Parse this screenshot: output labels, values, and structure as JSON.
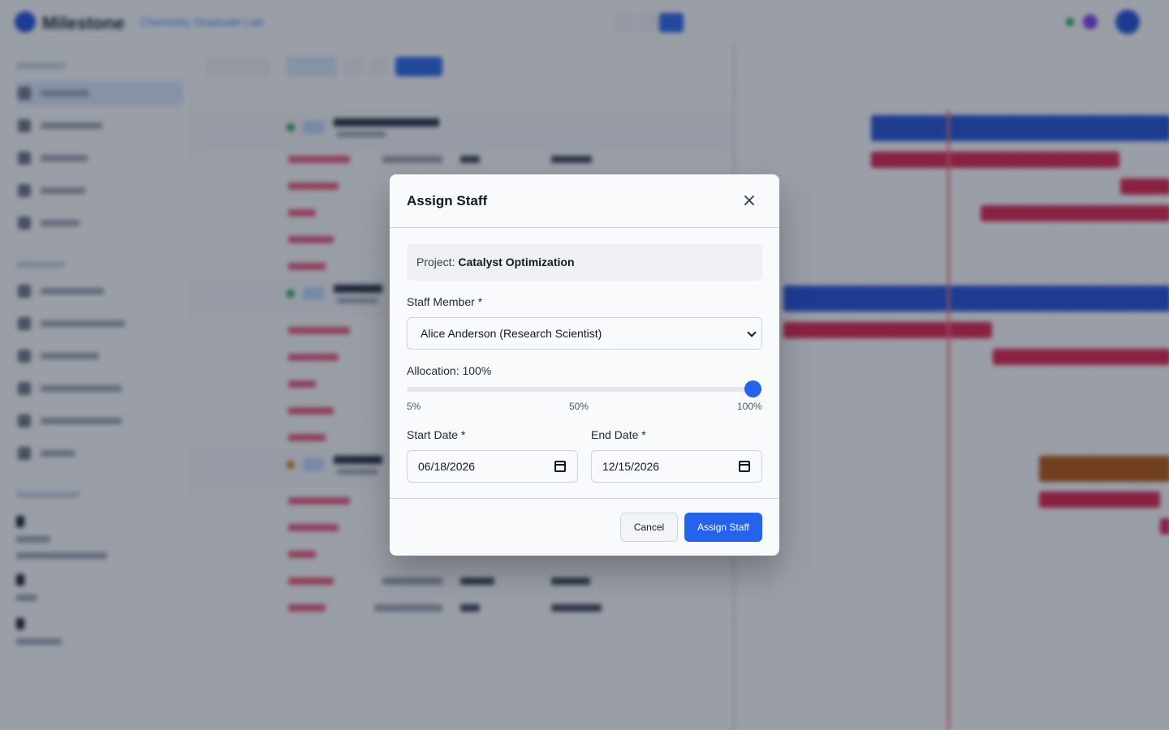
{
  "app": {
    "name": "Milestone",
    "org_link": "Chemistry Graduate Lab"
  },
  "modal": {
    "title": "Assign Staff",
    "close_glyph": "×",
    "project_label": "Project:",
    "project_name": "Catalyst Optimization",
    "staff_label": "Staff Member *",
    "staff_selected": "Alice Anderson (Research Scientist)",
    "allocation_label": "Allocation:",
    "allocation_value": "100%",
    "allocation_fraction": 1.0,
    "allocation_ticks": [
      "5%",
      "50%",
      "100%"
    ],
    "start_label": "Start Date *",
    "start_value": "06/18/2026",
    "end_label": "End Date *",
    "end_value": "12/15/2026",
    "cancel_label": "Cancel",
    "submit_label": "Assign Staff"
  },
  "colors": {
    "primary": "#2563eb",
    "task_bar": "#e11d48",
    "project_bar": "#1d4ed8",
    "today_line": "#f87171"
  }
}
